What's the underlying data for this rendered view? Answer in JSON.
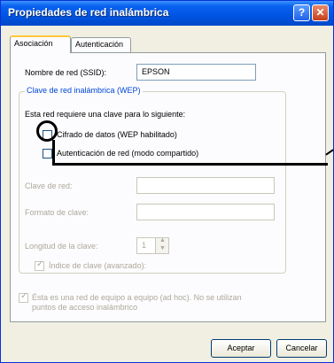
{
  "window": {
    "title": "Propiedades de red inalámbrica",
    "help_symbol": "?",
    "close_symbol": "✕"
  },
  "tabs": [
    "Asociación",
    "Autenticación"
  ],
  "ssid": {
    "label": "Nombre de red (SSID):",
    "value": "EPSON"
  },
  "wep_group": {
    "title": "Clave de red inalámbrica (WEP)",
    "intro": "Esta red requiere una clave para lo siguiente:",
    "encryption_label": "Cifrado de datos (WEP habilitado)",
    "encryption_checked": false,
    "auth_label": "Autenticación de red (modo compartido)",
    "auth_checked": false,
    "key_label": "Clave de red:",
    "format_label": "Formato de clave:",
    "length_label": "Longitud de la clave:",
    "length_value": "1",
    "index_label": "Índice de clave (avanzado):",
    "index_checked": true
  },
  "adhoc": {
    "label_line1": "Ésta es una red de equipo a equipo (ad hoc). No se utilizan",
    "label_line2": "puntos de acceso inalámbrico",
    "checked": true
  },
  "buttons": {
    "ok": "Aceptar",
    "cancel": "Cancelar"
  }
}
